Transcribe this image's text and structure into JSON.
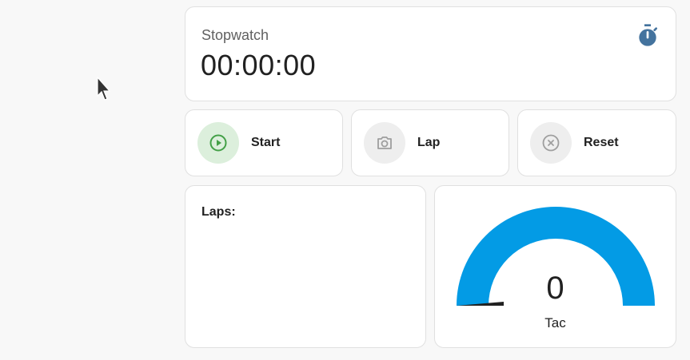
{
  "stopwatch": {
    "title": "Stopwatch",
    "time": "00:00:00",
    "icon": "timer-icon",
    "icon_color": "#44739e"
  },
  "buttons": {
    "start": {
      "label": "Start",
      "icon": "play-circle-icon",
      "icon_color": "#43a047",
      "bg_color": "#dcefdc"
    },
    "lap": {
      "label": "Lap",
      "icon": "camera-icon",
      "icon_color": "#9e9e9e",
      "bg_color": "#eeeeee"
    },
    "reset": {
      "label": "Reset",
      "icon": "close-circle-icon",
      "icon_color": "#9e9e9e",
      "bg_color": "#eeeeee"
    }
  },
  "laps": {
    "title": "Laps:"
  },
  "gauge": {
    "value": "0",
    "label": "Tac",
    "level": 0,
    "arc_color": "#039be5",
    "needle_color": "#212121"
  }
}
